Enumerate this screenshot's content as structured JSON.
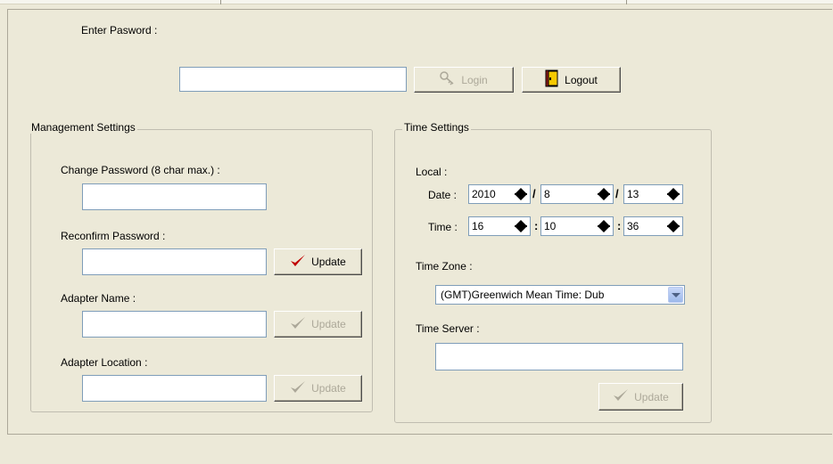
{
  "login": {
    "password_label": "Enter Pasword :",
    "password_value": "",
    "login_label": "Login",
    "logout_label": "Logout"
  },
  "management": {
    "title": "Management Settings",
    "change_password_label": "Change Password (8 char max.) :",
    "change_password_value": "",
    "reconfirm_label": "Reconfirm Password :",
    "reconfirm_value": "",
    "adapter_name_label": "Adapter Name :",
    "adapter_name_value": "",
    "adapter_location_label": "Adapter Location :",
    "adapter_location_value": "",
    "update_label": "Update"
  },
  "time": {
    "title": "Time Settings",
    "local_label": "Local :",
    "date_label": "Date :",
    "year": "2010",
    "month": "8",
    "day": "13",
    "date_sep": "/",
    "time_label": "Time :",
    "hour": "16",
    "minute": "10",
    "second": "36",
    "time_sep": ":",
    "timezone_label": "Time Zone :",
    "timezone_value": "(GMT)Greenwich Mean Time: Dub",
    "server_label": "Time Server :",
    "server_value": "",
    "update_label": "Update"
  },
  "colors": {
    "background": "#ece9d8",
    "field_border": "#7f9db9",
    "disabled_text": "#aca899",
    "check_red": "#c00000"
  },
  "icons": {
    "login": "key-icon",
    "logout": "door-exit-icon",
    "update": "checkmark-icon",
    "spinner": "spinner-up-down-icon",
    "dropdown": "chevron-down-icon"
  }
}
